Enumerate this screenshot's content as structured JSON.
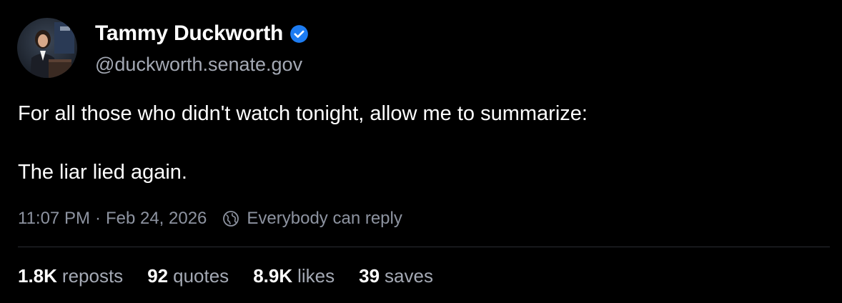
{
  "author": {
    "display_name": "Tammy Duckworth",
    "handle": "@duckworth.senate.gov",
    "verified": true,
    "verified_color": "#1d7cf2"
  },
  "post": {
    "lines": [
      "For all those who didn't watch tonight, allow me to summarize:",
      "The liar lied again."
    ],
    "time": "11:07 PM",
    "separator": "·",
    "date": "Feb 24, 2026",
    "reply_setting": "Everybody can reply",
    "reply_icon": "globe-icon"
  },
  "stats": {
    "reposts": {
      "count": "1.8K",
      "label": "reposts"
    },
    "quotes": {
      "count": "92",
      "label": "quotes"
    },
    "likes": {
      "count": "8.9K",
      "label": "likes"
    },
    "saves": {
      "count": "39",
      "label": "saves"
    }
  },
  "colors": {
    "background": "#000000",
    "text": "#ffffff",
    "secondary_text": "#a4a9b4",
    "meta_text": "#8d93a0",
    "divider": "#2a2d33"
  }
}
